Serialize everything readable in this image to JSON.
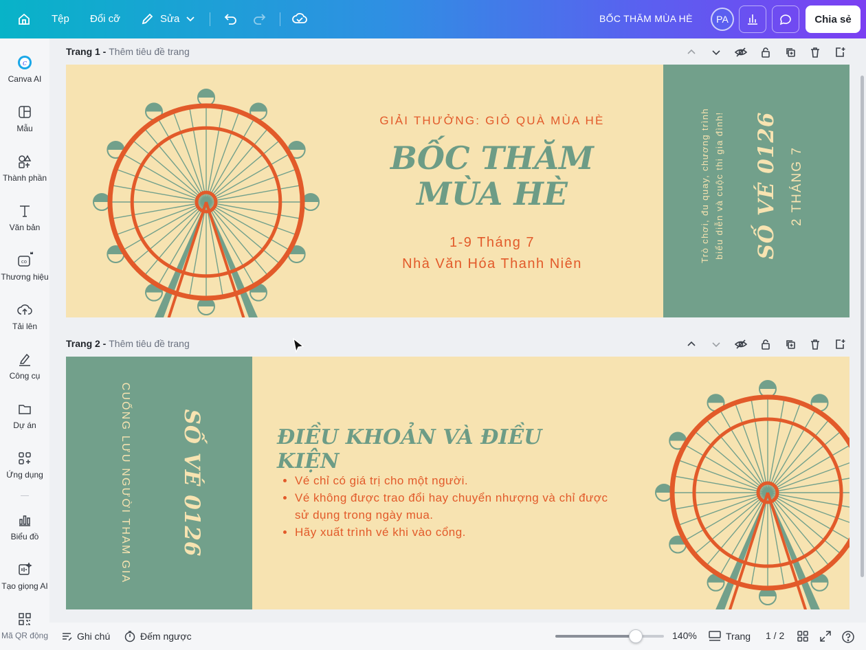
{
  "topbar": {
    "file_label": "Tệp",
    "resize_label": "Đổi cỡ",
    "edit_label": "Sửa",
    "doc_title": "BỐC THĂM MÙA HÈ",
    "avatar_initials": "PA",
    "share_label": "Chia sẻ"
  },
  "sidebar": {
    "items": [
      {
        "label": "Canva AI",
        "icon": "canva-ai-icon"
      },
      {
        "label": "Mẫu",
        "icon": "templates-icon"
      },
      {
        "label": "Thành phần",
        "icon": "elements-icon"
      },
      {
        "label": "Văn bản",
        "icon": "text-icon"
      },
      {
        "label": "Thương hiệu",
        "icon": "brand-icon"
      },
      {
        "label": "Tải lên",
        "icon": "upload-icon"
      },
      {
        "label": "Công cụ",
        "icon": "draw-icon"
      },
      {
        "label": "Dự án",
        "icon": "folder-icon"
      },
      {
        "label": "Ứng dụng",
        "icon": "apps-icon"
      },
      {
        "label": "Biểu đồ",
        "icon": "chart-icon"
      },
      {
        "label": "Tạo giọng AI",
        "icon": "ai-voice-icon"
      },
      {
        "label": "Mã QR động",
        "icon": "qr-code-icon"
      }
    ]
  },
  "pages": [
    {
      "label": "Trang 1 - ",
      "placeholder": "Thêm tiêu đề trang",
      "prize": "GIẢI THƯỞNG: GIỎ QUÀ MÙA HÈ",
      "title_line1": "BỐC THĂM",
      "title_line2": "MÙA HÈ",
      "date": "1-9 Tháng 7",
      "venue": "Nhà Văn Hóa Thanh Niên",
      "side_small_line1": "Trò chơi, đu quay, chương trình",
      "side_small_line2": "biểu diễn và cuộc thi gia đình!",
      "ticket_no": "SỐ VÉ 0126",
      "ticket_date": "2 THÁNG 7"
    },
    {
      "label": "Trang 2 - ",
      "placeholder": "Thêm tiêu đề trang",
      "stub_caption": "CUỐNG LƯU NGƯỜI THAM GIA",
      "ticket_no": "SỐ VÉ 0126",
      "terms_title": "ĐIỀU KHOẢN VÀ ĐIỀU KIỆN",
      "terms": [
        "Vé chỉ có giá trị cho một người.",
        "Vé không được trao đổi hay chuyển nhượng và chỉ được sử dụng trong ngày mua.",
        "Hãy xuất trình vé khi vào cổng."
      ]
    }
  ],
  "bottombar": {
    "notes_label": "Ghi chú",
    "timer_label": "Đếm ngược",
    "zoom": "140%",
    "zoom_fraction": 0.74,
    "pages_label": "Trang",
    "page_indicator": "1 / 2"
  },
  "colors": {
    "cream": "#f7e3b1",
    "green": "#72a08b",
    "orange": "#e25a2a"
  }
}
